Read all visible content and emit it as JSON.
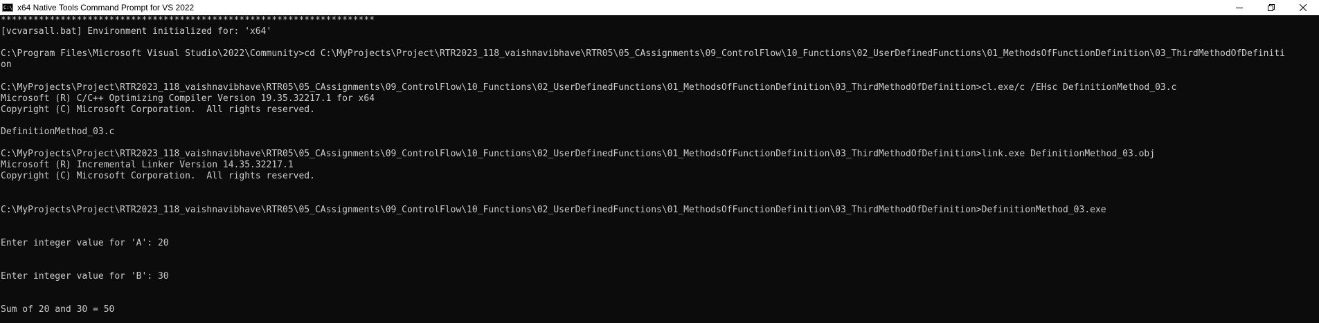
{
  "window": {
    "title": "x64 Native Tools Command Prompt for VS 2022",
    "icon_label": "C:\\",
    "icon": "cmd-icon"
  },
  "controls": {
    "minimize_icon": "minimize-icon",
    "restore_icon": "restore-icon",
    "close_icon": "close-icon"
  },
  "console": {
    "lines": [
      "*********************************************************************",
      "[vcvarsall.bat] Environment initialized for: 'x64'",
      "",
      "C:\\Program Files\\Microsoft Visual Studio\\2022\\Community>cd C:\\MyProjects\\Project\\RTR2023_118_vaishnavibhave\\RTR05\\05_CAssignments\\09_ControlFlow\\10_Functions\\02_UserDefinedFunctions\\01_MethodsOfFunctionDefinition\\03_ThirdMethodOfDefiniti",
      "on",
      "",
      "C:\\MyProjects\\Project\\RTR2023_118_vaishnavibhave\\RTR05\\05_CAssignments\\09_ControlFlow\\10_Functions\\02_UserDefinedFunctions\\01_MethodsOfFunctionDefinition\\03_ThirdMethodOfDefinition>cl.exe/c /EHsc DefinitionMethod_03.c",
      "Microsoft (R) C/C++ Optimizing Compiler Version 19.35.32217.1 for x64",
      "Copyright (C) Microsoft Corporation.  All rights reserved.",
      "",
      "DefinitionMethod_03.c",
      "",
      "C:\\MyProjects\\Project\\RTR2023_118_vaishnavibhave\\RTR05\\05_CAssignments\\09_ControlFlow\\10_Functions\\02_UserDefinedFunctions\\01_MethodsOfFunctionDefinition\\03_ThirdMethodOfDefinition>link.exe DefinitionMethod_03.obj",
      "Microsoft (R) Incremental Linker Version 14.35.32217.1",
      "Copyright (C) Microsoft Corporation.  All rights reserved.",
      "",
      "",
      "C:\\MyProjects\\Project\\RTR2023_118_vaishnavibhave\\RTR05\\05_CAssignments\\09_ControlFlow\\10_Functions\\02_UserDefinedFunctions\\01_MethodsOfFunctionDefinition\\03_ThirdMethodOfDefinition>DefinitionMethod_03.exe",
      "",
      "",
      "Enter integer value for 'A': 20",
      "",
      "",
      "Enter integer value for 'B': 30",
      "",
      "",
      "Sum of 20 and 30 = 50"
    ]
  },
  "colors": {
    "background": "#0c0c0c",
    "text": "#cccccc",
    "titlebar": "#ffffff"
  }
}
